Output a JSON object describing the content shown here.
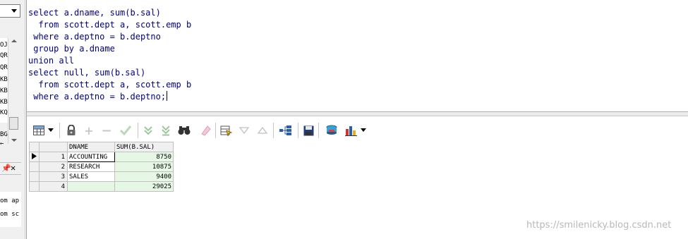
{
  "left_panel": {
    "list_snippets": [
      "OJI",
      "QRS",
      "QRS",
      "KBA",
      "KBI",
      "KBC",
      "KQI"
    ],
    "mid_snippets": [
      "BG",
      "←"
    ],
    "bottom_snippets": [
      "om ap",
      "om sc"
    ]
  },
  "editor": {
    "lines": [
      "select a.dname, sum(b.sal)",
      "  from scott.dept a, scott.emp b",
      " where a.deptno = b.deptno",
      " group by a.dname",
      "union all",
      "select null, sum(b.sal)",
      "  from scott.dept a, scott.emp b",
      " where a.deptno = b.deptno;"
    ]
  },
  "toolbar": {
    "icons": [
      "grid-view-icon",
      "lock-icon",
      "add-record-icon",
      "delete-record-icon",
      "post-changes-icon",
      "fetch-next-icon",
      "fetch-last-icon",
      "find-icon",
      "clear-icon",
      "query-by-example-icon",
      "previous-query-icon",
      "next-query-icon",
      "export-icon",
      "save-icon",
      "query-browser-icon",
      "chart-icon"
    ]
  },
  "grid": {
    "columns": [
      "DNAME",
      "SUM(B.SAL)"
    ],
    "rows": [
      {
        "num": "1",
        "dname": "ACCOUNTING",
        "sal": "8750"
      },
      {
        "num": "2",
        "dname": "RESEARCH",
        "sal": "10875"
      },
      {
        "num": "3",
        "dname": "SALES",
        "sal": "9400"
      },
      {
        "num": "4",
        "dname": "",
        "sal": "29025"
      }
    ]
  },
  "watermark": "https://smilenicky.blog.csdn.net",
  "colors": {
    "sql_keyword": "#000080",
    "grid_highlight": "#e6f7e6"
  }
}
